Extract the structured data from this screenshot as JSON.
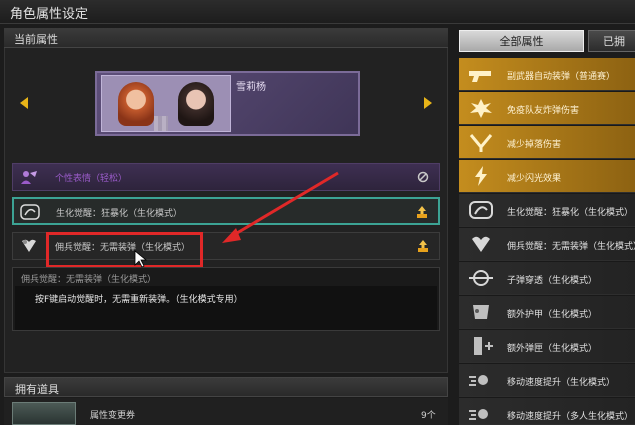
{
  "window": {
    "title": "角色属性设定"
  },
  "current_attrs": {
    "heading": "当前属性",
    "character_name": "雪莉杨",
    "rows": [
      {
        "label": "个性表情（轻松）",
        "icon": "mask-icon",
        "action_icon": "prohibited-icon"
      },
      {
        "label": "生化觉醒：狂暴化（生化模式）",
        "icon": "rage-icon",
        "action_icon": "upgrade-icon"
      },
      {
        "label": "佣兵觉醒：无需装弹（生化模式）",
        "icon": "heart-shield-icon",
        "action_icon": "upgrade-icon"
      }
    ],
    "description": {
      "title": "佣兵觉醒：无需装弹（生化模式）",
      "body": "按F键启动觉醒时，无需重新装弹。（生化模式专用）"
    }
  },
  "owned_items": {
    "heading": "拥有道具",
    "items": [
      {
        "name": "属性变更券",
        "count": "9个"
      }
    ]
  },
  "tabs": {
    "all": "全部属性",
    "other": "已拥"
  },
  "attribute_list": [
    {
      "label": "副武器自动装弹（普通赛）",
      "style": "gold",
      "icon": "pistol-icon"
    },
    {
      "label": "免疫队友炸弹伤害",
      "style": "gold",
      "icon": "explosion-icon"
    },
    {
      "label": "减少掉落伤害",
      "style": "gold",
      "icon": "fall-icon"
    },
    {
      "label": "减少闪光效果",
      "style": "gold",
      "icon": "flash-icon"
    },
    {
      "label": "生化觉醒：狂暴化（生化模式）",
      "style": "dark",
      "icon": "rage-icon"
    },
    {
      "label": "佣兵觉醒：无需装弹（生化模式）",
      "style": "dark",
      "icon": "heart-shield-icon"
    },
    {
      "label": "子弹穿透（生化模式）",
      "style": "dark",
      "icon": "bullet-pierce-icon"
    },
    {
      "label": "额外护甲（生化模式）",
      "style": "dark",
      "icon": "armor-icon"
    },
    {
      "label": "额外弹匣（生化模式）",
      "style": "dark",
      "icon": "magazine-icon"
    },
    {
      "label": "移动速度提升（生化模式）",
      "style": "dark",
      "icon": "speed-icon"
    },
    {
      "label": "移动速度提升（多人生化模式）",
      "style": "dark",
      "icon": "speed-icon"
    }
  ],
  "colors": {
    "accent_gold": "#c48d1e",
    "selected_border": "#3ca394",
    "annotation_red": "#e02828"
  }
}
